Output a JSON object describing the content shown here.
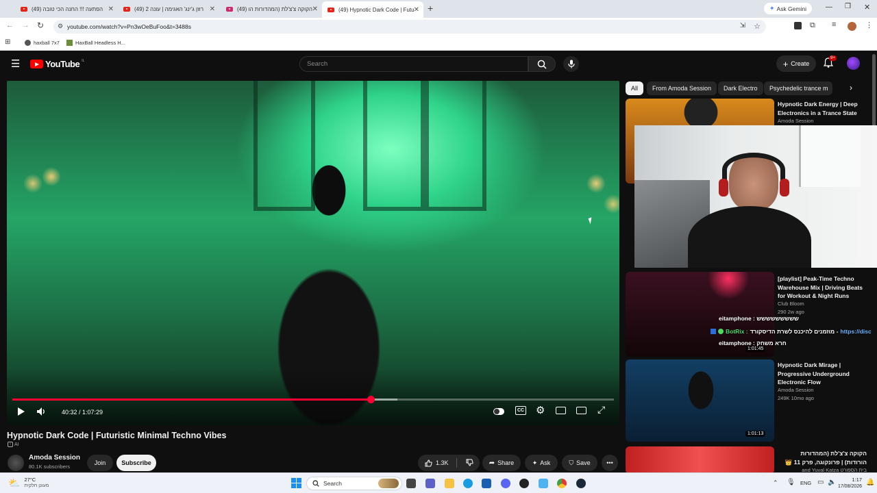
{
  "browser": {
    "tabs": [
      {
        "title": "(49) הפתעה !!! החנה הכי טובה"
      },
      {
        "title": "(49) רוזן ג'ינג' האגימה | עונה 2"
      },
      {
        "title": "(49) הקוקה צ'צ'לת (המהדורות הו"
      },
      {
        "title": "(49) Hypnotic Dark Code | Futu"
      }
    ],
    "new_tab": "+",
    "ask_gemini": "Ask Gemini",
    "url": "youtube.com/watch?v=Pn3wOeBuFoo&t=3488s",
    "bookmarks": [
      {
        "label": "haxball 7x7"
      },
      {
        "label": "HaxBall Headless H..."
      }
    ]
  },
  "youtube": {
    "logo_text": "YouTube",
    "logo_country": "IL",
    "search_placeholder": "Search",
    "create_label": "Create",
    "notif_count": "9+",
    "chips": [
      "All",
      "From Amoda Session",
      "Dark Electro",
      "Psychedelic trance m"
    ],
    "player": {
      "time": "40:32 / 1:07:29",
      "progress": 0.596
    },
    "video_title": "Hypnotic Dark Code | Futuristic Minimal Techno Vibes",
    "ai_badge": "AI",
    "channel": {
      "name": "Amoda Session",
      "subs": "80.1K subscribers",
      "join": "Join",
      "subscribe": "Subscribe"
    },
    "actions": {
      "likes": "1.3K",
      "share": "Share",
      "ask": "Ask",
      "save": "Save"
    },
    "recommendations": [
      {
        "title": "Hypnotic Dark Energy | Deep Electronics in a Trance State",
        "channel": "Amoda Session"
      },
      {
        "title": "[playlist] Peak-Time Techno Warehouse Mix | Driving Beats for Workout & Night Runs",
        "channel": "Club Bloom",
        "stats": "290  2w ago",
        "duration": "1:01:45"
      },
      {
        "title": "Hypnotic Dark Mirage | Progressive Underground Electronic Flow",
        "channel": "Amoda Session",
        "stats": "249K  10mo ago",
        "duration": "1:01:13"
      },
      {
        "title": "הקוקה צ'צ'לת (המהדורות הורודות) | פרונקוגה, פרק 11 👑",
        "channel": "בית הספורט and Yuval Katza"
      }
    ],
    "chat": [
      {
        "user": "eitamphone :",
        "text": "ששששששששש"
      },
      {
        "user": "BotRix :",
        "text": "מוזמנים להיכנס לשרת הדיסקורד -",
        "link": "https://disc"
      },
      {
        "user": "eitamphone :",
        "text": "חרא משחק"
      }
    ]
  },
  "taskbar": {
    "weather_temp": "27°C",
    "weather_desc": "מעונן חלקית",
    "search_label": "Search",
    "lang": "ENG",
    "time": "1:17",
    "date": "17/08/2026"
  },
  "colors": {
    "yt_red": "#ff0000",
    "progress_red": "#ff0033",
    "botrix_green": "#4cd964"
  }
}
